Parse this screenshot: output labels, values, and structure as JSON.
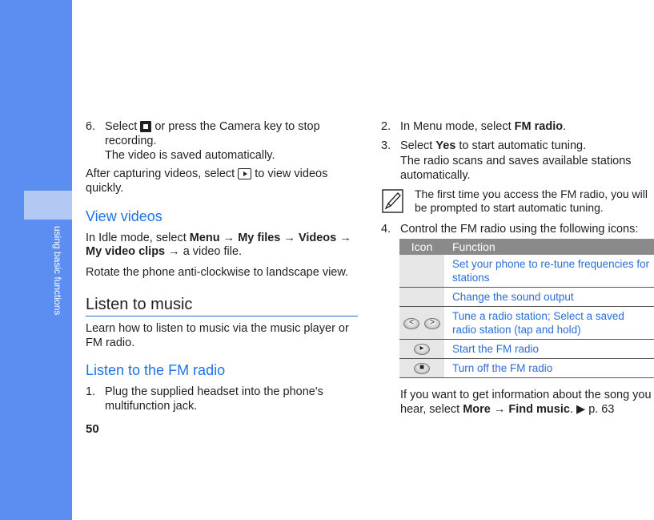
{
  "sidebar": {
    "section_label": "using basic functions"
  },
  "page_number": "50",
  "left": {
    "step6": {
      "number": "6.",
      "pre": "Select ",
      "post": " or press the Camera key to stop",
      "line2": "recording.",
      "line3": "The video is saved automatically."
    },
    "after": {
      "pre": "After capturing videos, select ",
      "post": " to view videos",
      "line2": "quickly."
    },
    "view_videos": {
      "heading": "View videos",
      "line1_pre": "In Idle mode, select ",
      "menu": "Menu",
      "arrow": "→",
      "my_files": "My files",
      "videos": "Videos",
      "my_video_clips": "My video clips",
      "line2_post": "a video file.",
      "rotate": "Rotate the phone anti-clockwise to landscape view."
    },
    "listen_music": {
      "heading": "Listen to music",
      "line1": "Learn how to listen to music via the music player or",
      "line2": "FM radio."
    },
    "fm_radio": {
      "heading": "Listen to the FM radio",
      "step1_number": "1.",
      "step1_line1": "Plug the supplied headset into the phone's",
      "step1_line2": "multifunction jack."
    }
  },
  "right": {
    "step2": {
      "number": "2.",
      "pre": "In Menu mode, select ",
      "bold": "FM radio",
      "post": "."
    },
    "step3": {
      "number": "3.",
      "pre": "Select ",
      "bold": "Yes",
      "post": " to start automatic tuning.",
      "line2": "The radio scans and saves available stations",
      "line3": "automatically."
    },
    "note": {
      "line1": "The first time you access the FM radio, you will",
      "line2": "be prompted to start automatic tuning."
    },
    "step4": {
      "number": "4.",
      "text": "Control the FM radio using the following icons:"
    },
    "table": {
      "headers": [
        "Icon",
        "Function"
      ],
      "rows": [
        {
          "icon": "",
          "function": "Set your phone to re-tune frequencies for stations"
        },
        {
          "icon": "",
          "function": "Change the sound output"
        },
        {
          "icon": "prev-next-buttons",
          "function": "Tune a radio station; Select a saved radio station (tap and hold)"
        },
        {
          "icon": "play-button",
          "function": "Start the FM radio"
        },
        {
          "icon": "stop-button",
          "function": "Turn off the FM radio"
        }
      ]
    },
    "footer": {
      "line1": "If you want to get information about the song you",
      "line2_pre": "hear, select ",
      "more": "More",
      "arrow": "→",
      "find_music": "Find music",
      "post": ". ▶ p. 63"
    }
  }
}
